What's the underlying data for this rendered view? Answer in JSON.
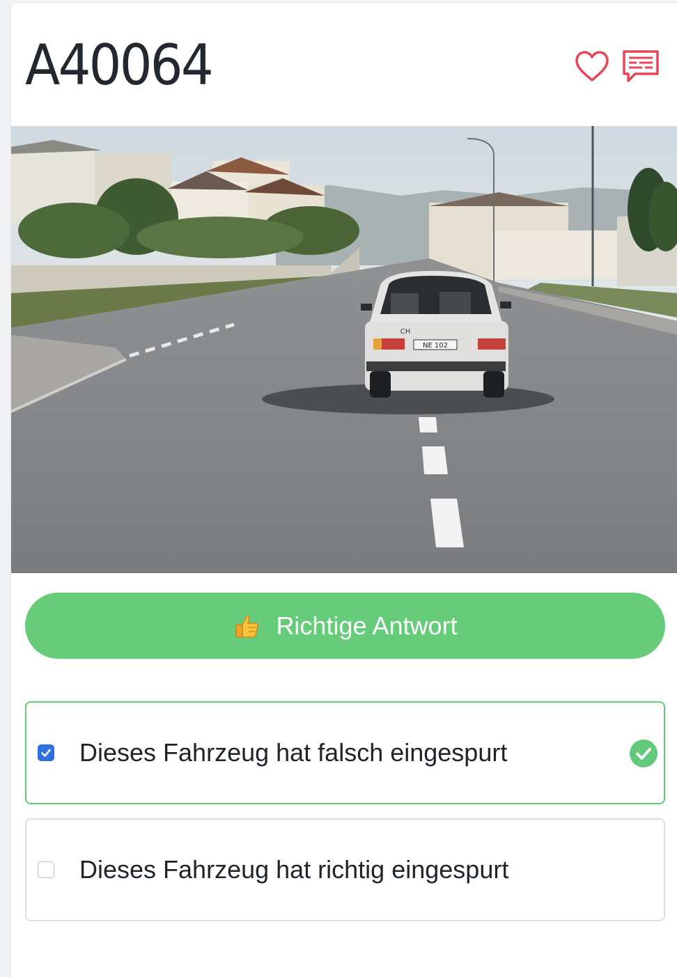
{
  "question": {
    "id": "A40064"
  },
  "header_icons": {
    "favorite": "heart-icon",
    "comment": "comment-icon",
    "accent_color": "#e8455a"
  },
  "result": {
    "label": "Richtige Antwort",
    "emoji": "thumbs-up-icon",
    "color": "#66cc7a"
  },
  "options": [
    {
      "text": "Dieses Fahrzeug hat falsch eingespurt",
      "checked": true,
      "correct": true
    },
    {
      "text": "Dieses Fahrzeug hat richtig eingespurt",
      "checked": false,
      "correct": false
    }
  ],
  "photo": {
    "plate_text": "NE 102",
    "country_badge": "CH"
  }
}
